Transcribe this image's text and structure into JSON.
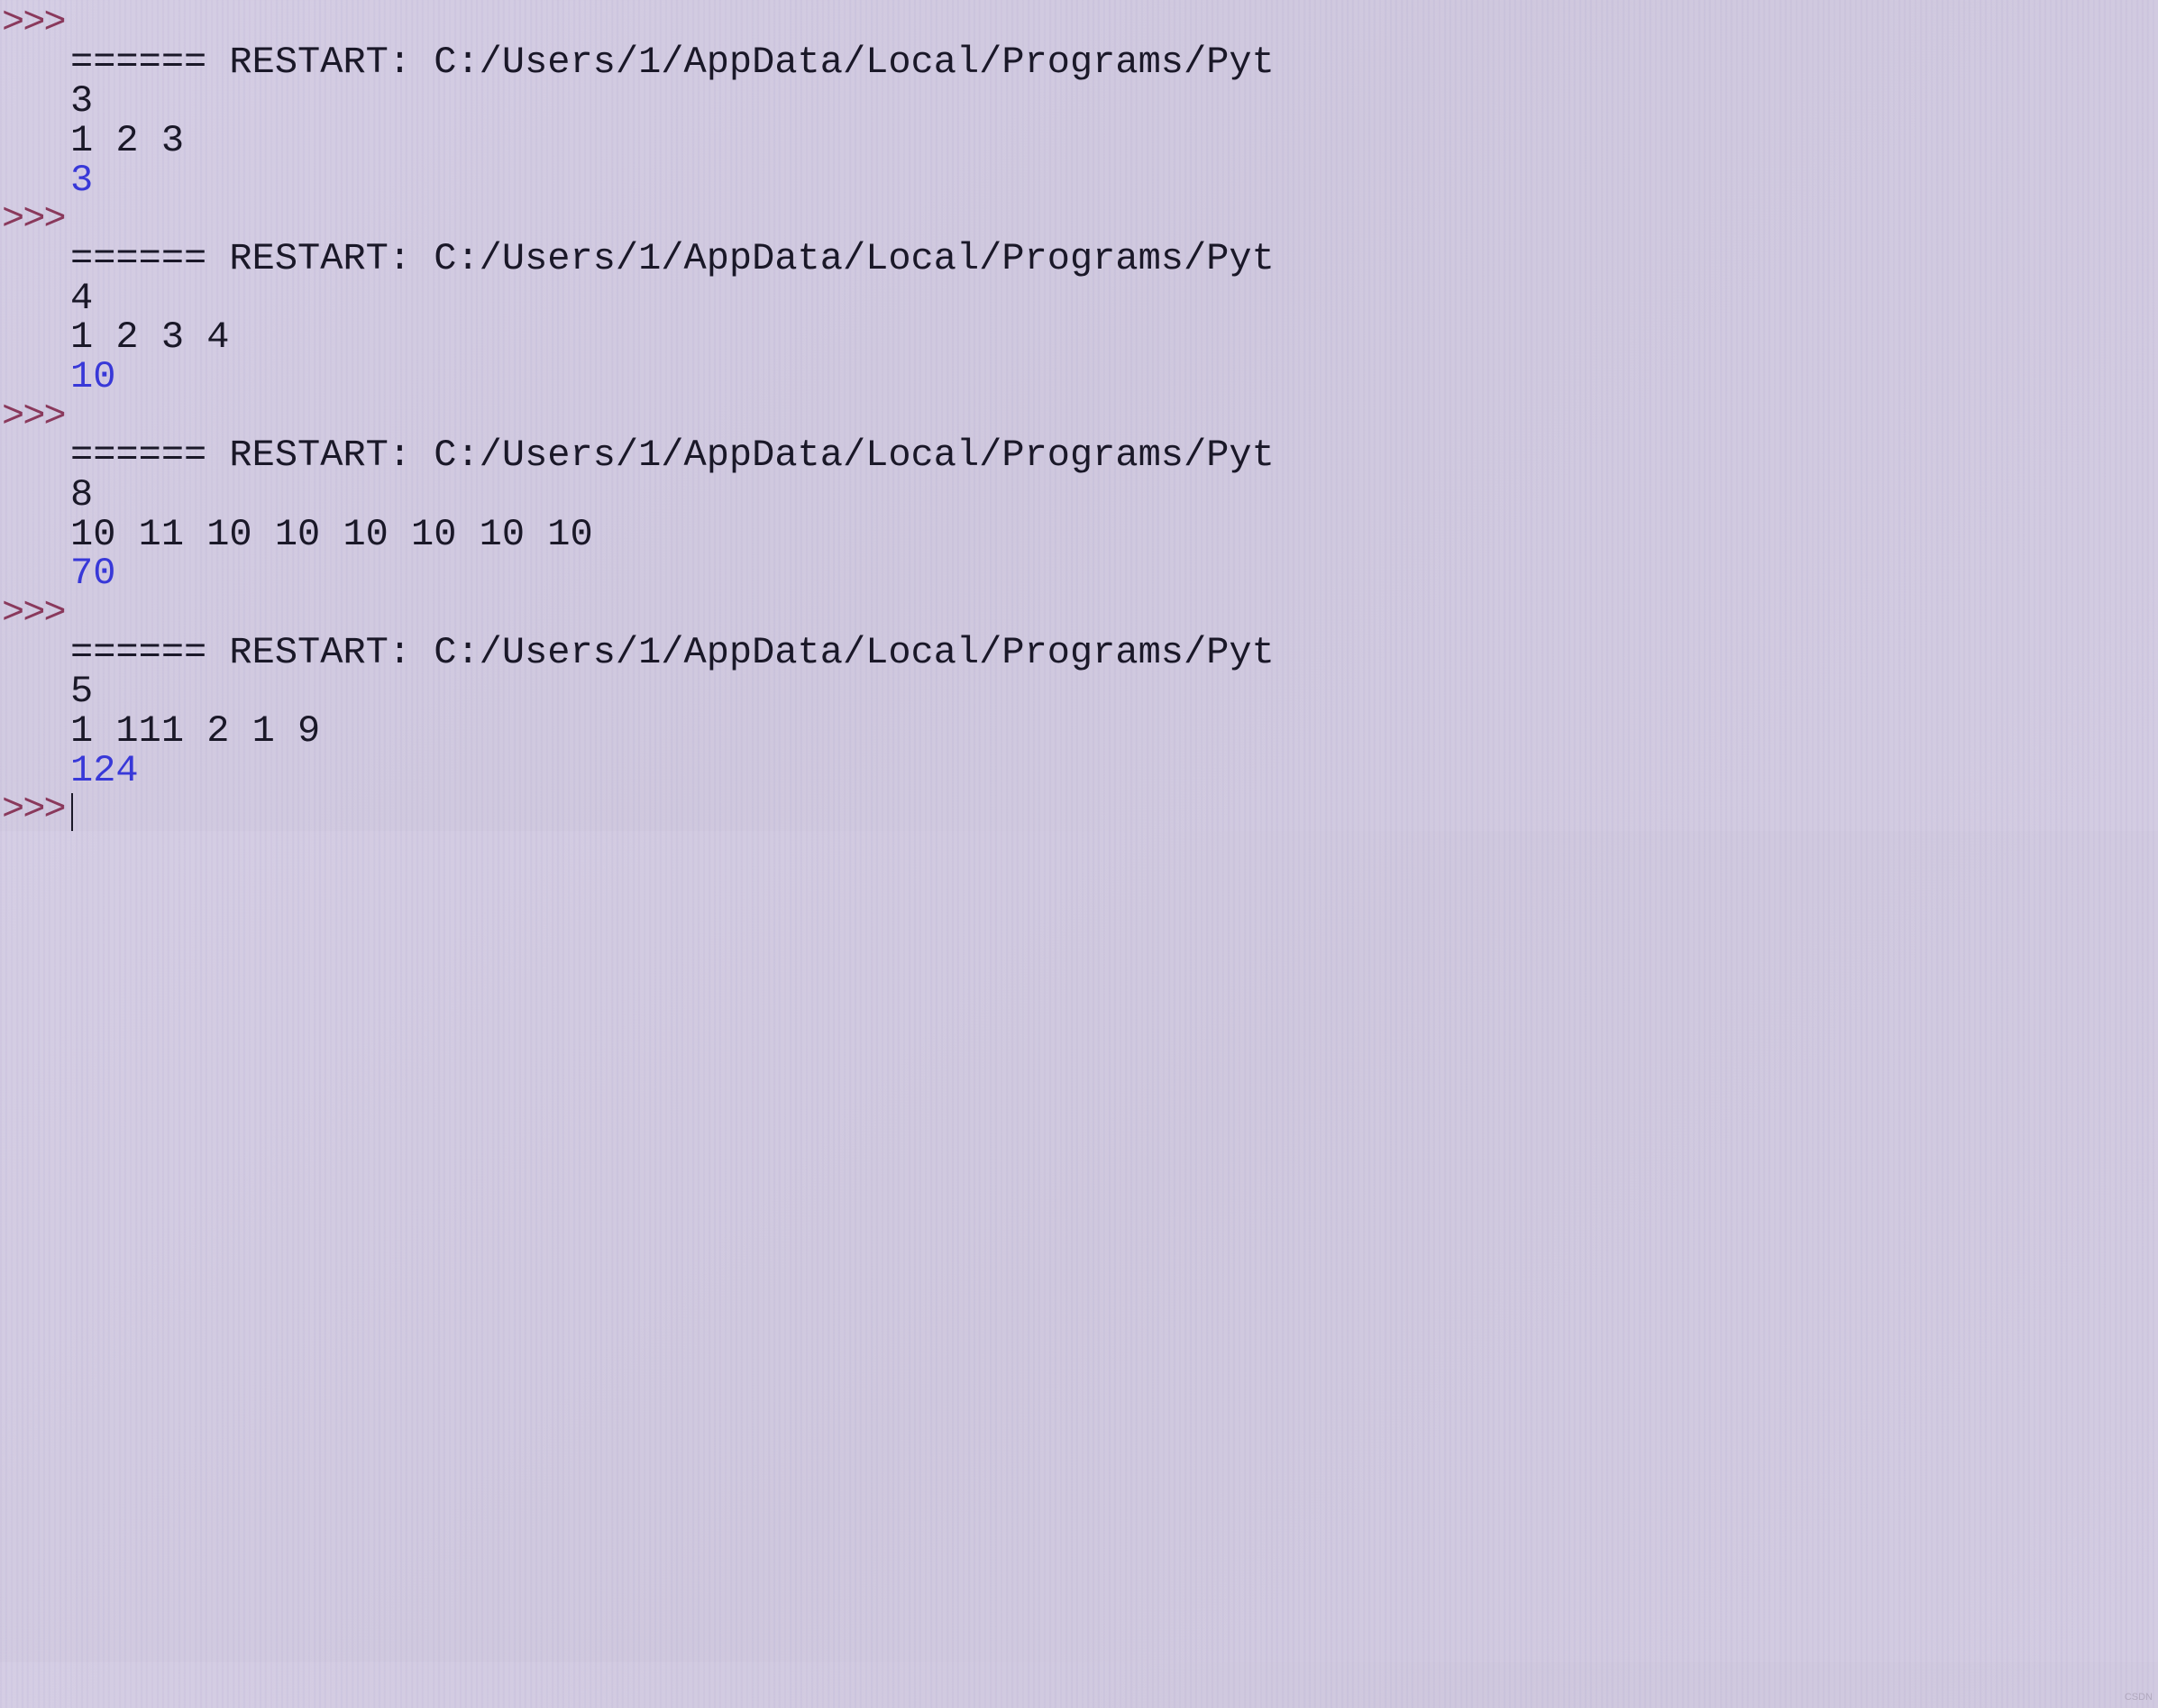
{
  "prompt_symbol": ">>>",
  "restart_prefix": "====== RESTART: ",
  "restart_path": "C:/Users/1/AppData/Local/Programs/Pyt",
  "runs": [
    {
      "input_n": "3",
      "input_values": "1 2 3",
      "output": "3"
    },
    {
      "input_n": "4",
      "input_values": "1 2 3 4",
      "output": "10"
    },
    {
      "input_n": "8",
      "input_values": "10 11 10 10 10 10 10 10",
      "output": "70"
    },
    {
      "input_n": "5",
      "input_values": "1 111 2 1 9",
      "output": "124"
    }
  ],
  "watermark": "CSDN"
}
